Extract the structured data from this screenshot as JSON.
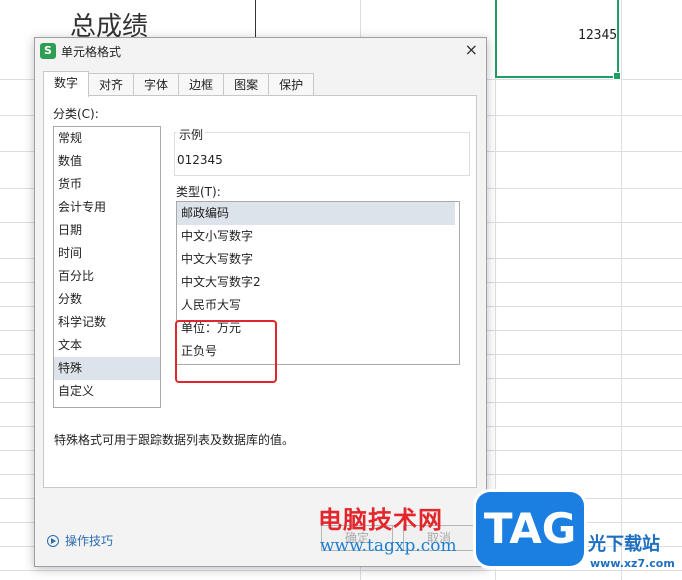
{
  "sheet": {
    "header_text": "总成绩",
    "cell_value": "12345"
  },
  "dialog": {
    "title": "单元格格式",
    "app_icon_letter": "S",
    "close_glyph": "×",
    "tabs": [
      "数字",
      "对齐",
      "字体",
      "边框",
      "图案",
      "保护"
    ],
    "active_tab": "数字",
    "category_label": "分类(C):",
    "categories": [
      "常规",
      "数值",
      "货币",
      "会计专用",
      "日期",
      "时间",
      "百分比",
      "分数",
      "科学记数",
      "文本",
      "特殊",
      "自定义"
    ],
    "selected_category": "特殊",
    "sample_title": "示例",
    "sample_value": "012345",
    "type_label": "类型(T):",
    "types": [
      "邮政编码",
      "中文小写数字",
      "中文大写数字",
      "中文大写数字2",
      "人民币大写",
      "单位：万元",
      "正负号"
    ],
    "selected_type": "邮政编码",
    "description": "特殊格式可用于跟踪数据列表及数据库的值。",
    "tips_label": "操作技巧",
    "ok_label": "确定",
    "cancel_label": "取消"
  },
  "watermark": {
    "site_name": "电脑技术网",
    "site_url": "www.tagxp.com",
    "logo_text": "TAG",
    "brand_name": "光下载站",
    "brand_url": "www.xz7.com"
  },
  "colors": {
    "selection_border": "#1f9d63",
    "highlight_box": "#e0262a",
    "tip_link": "#2b6cb0"
  }
}
